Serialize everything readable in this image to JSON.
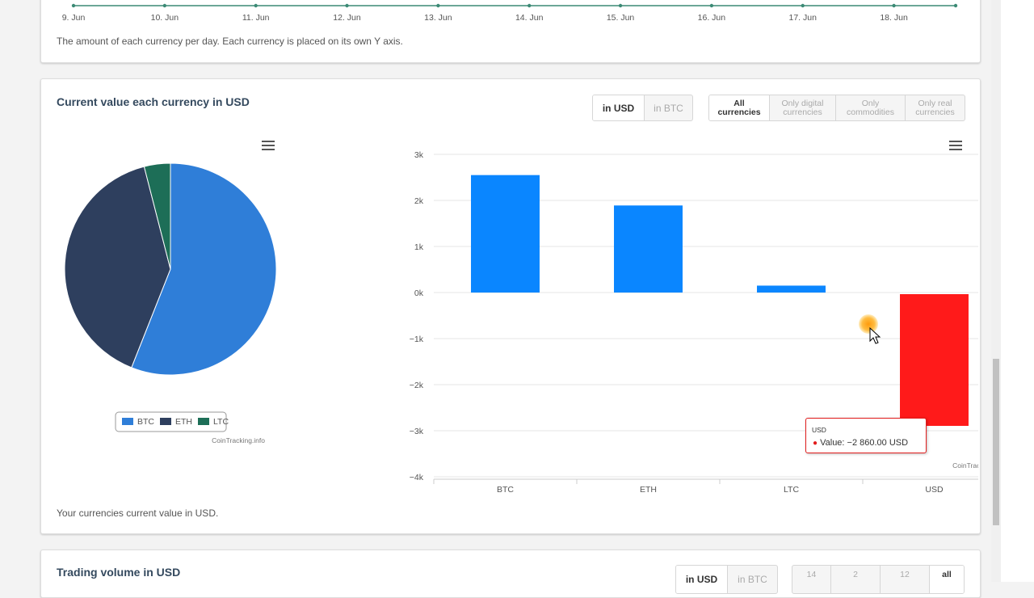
{
  "top_section": {
    "x_ticks": [
      "9. Jun",
      "10. Jun",
      "11. Jun",
      "12. Jun",
      "13. Jun",
      "14. Jun",
      "15. Jun",
      "16. Jun",
      "17. Jun",
      "18. Jun"
    ],
    "description": "The amount of each currency per day. Each currency is placed on its own Y axis."
  },
  "main_section": {
    "title": "Current value each currency in USD",
    "unit_toggle": [
      "in USD",
      "in BTC"
    ],
    "unit_selected": "in USD",
    "filter_buttons": [
      {
        "line1": "All",
        "line2": "currencies",
        "active": true
      },
      {
        "line1": "Only digital",
        "line2": "currencies",
        "active": false
      },
      {
        "line1": "Only",
        "line2": "commodities",
        "active": false
      },
      {
        "line1": "Only real",
        "line2": "currencies",
        "active": false
      }
    ],
    "credit": "CoinTracking.info",
    "description": "Your currencies current value in USD."
  },
  "tooltip": {
    "series": "USD",
    "text": "Value: −2 860.00 USD"
  },
  "bottom_section": {
    "title": "Trading volume in USD",
    "unit_toggle": [
      "in USD",
      "in BTC"
    ],
    "range_buttons": [
      "14",
      "2",
      "12",
      "all"
    ]
  },
  "colors": {
    "pie_btc": "#2f7ed8",
    "pie_eth": "#2e3f5e",
    "pie_ltc": "#1d6e57",
    "bar_positive": "#0a86ff",
    "bar_negative": "#ff1a1a",
    "accent_line": "#3c8a75"
  },
  "chart_data": [
    {
      "type": "pie",
      "categories": [
        "BTC",
        "ETH",
        "LTC"
      ],
      "values": [
        56,
        40,
        4
      ],
      "legend": [
        "BTC",
        "ETH",
        "LTC"
      ],
      "legend_position": "bottom"
    },
    {
      "type": "bar",
      "categories": [
        "BTC",
        "ETH",
        "LTC",
        "USD"
      ],
      "values": [
        2550,
        1890,
        150,
        -2860
      ],
      "ylim": [
        -4000,
        3000
      ],
      "y_ticks": [
        "3k",
        "2k",
        "1k",
        "0k",
        "−1k",
        "−2k",
        "−3k",
        "−4k"
      ],
      "grid": true
    }
  ]
}
